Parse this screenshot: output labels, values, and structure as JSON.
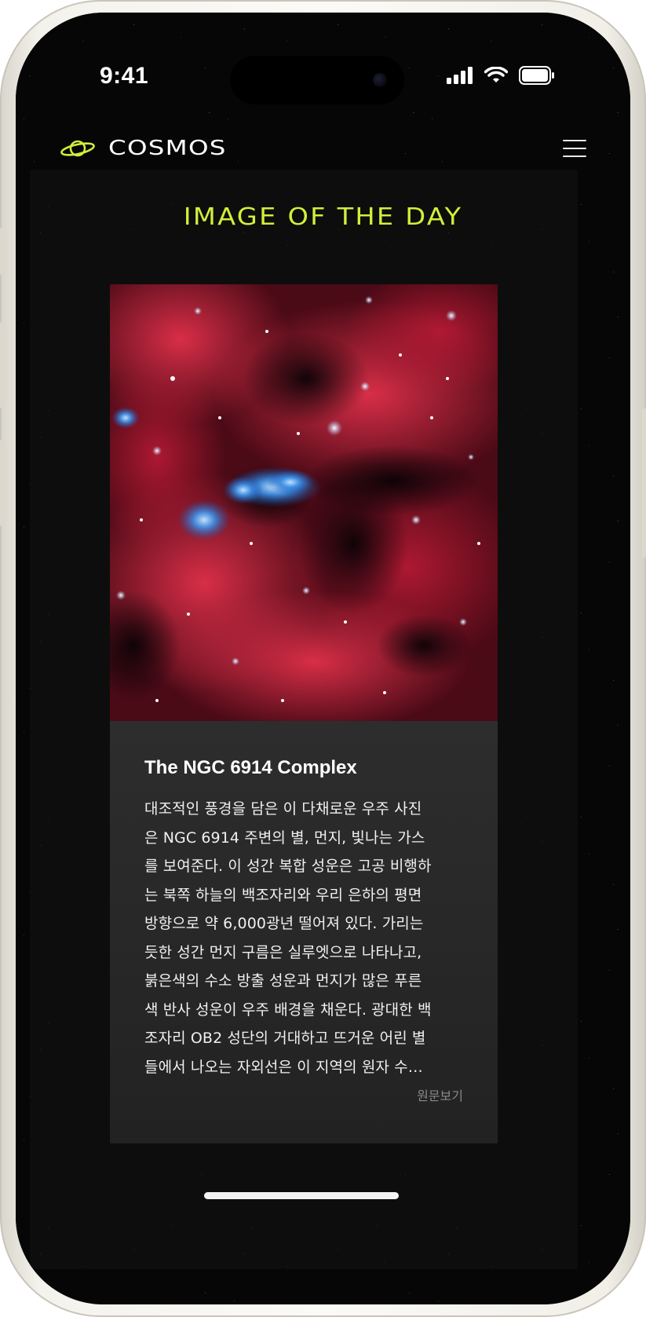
{
  "status_bar": {
    "time": "9:41",
    "icons": [
      "cellular-signal-icon",
      "wifi-icon",
      "battery-icon"
    ]
  },
  "nav": {
    "brand": "COSMOS",
    "logo_icon": "planet-icon",
    "menu_icon": "hamburger-menu-icon"
  },
  "page": {
    "section_title": "IMAGE OF THE DAY"
  },
  "article": {
    "image_subject": "NGC 6914 nebula",
    "title": "The NGC 6914 Complex",
    "body_lines": [
      "대조적인 풍경을 담은 이 다채로운 우주 사진",
      "은 NGC 6914 주변의 별, 먼지, 빛나는 가스",
      "를 보여준다. 이 성간 복합 성운은 고공 비행하",
      "는 북쪽 하늘의 백조자리와 우리 은하의 평면",
      "방향으로 약 6,000광년 떨어져 있다. 가리는",
      "듯한 성간 먼지 구름은 실루엣으로 나타나고,",
      "붉은색의 수소 방출 성운과 먼지가 많은 푸른",
      "색 반사 성운이 우주 배경을 채운다. 광대한 백",
      "조자리 OB2 성단의 거대하고 뜨거운 어린 별",
      "들에서 나오는 자외선은 이 지역의 원자 수…"
    ],
    "view_original_label": "원문보기"
  },
  "colors": {
    "accent": "#d2ee3a",
    "background": "#060606",
    "card": "#2e2e2e"
  }
}
